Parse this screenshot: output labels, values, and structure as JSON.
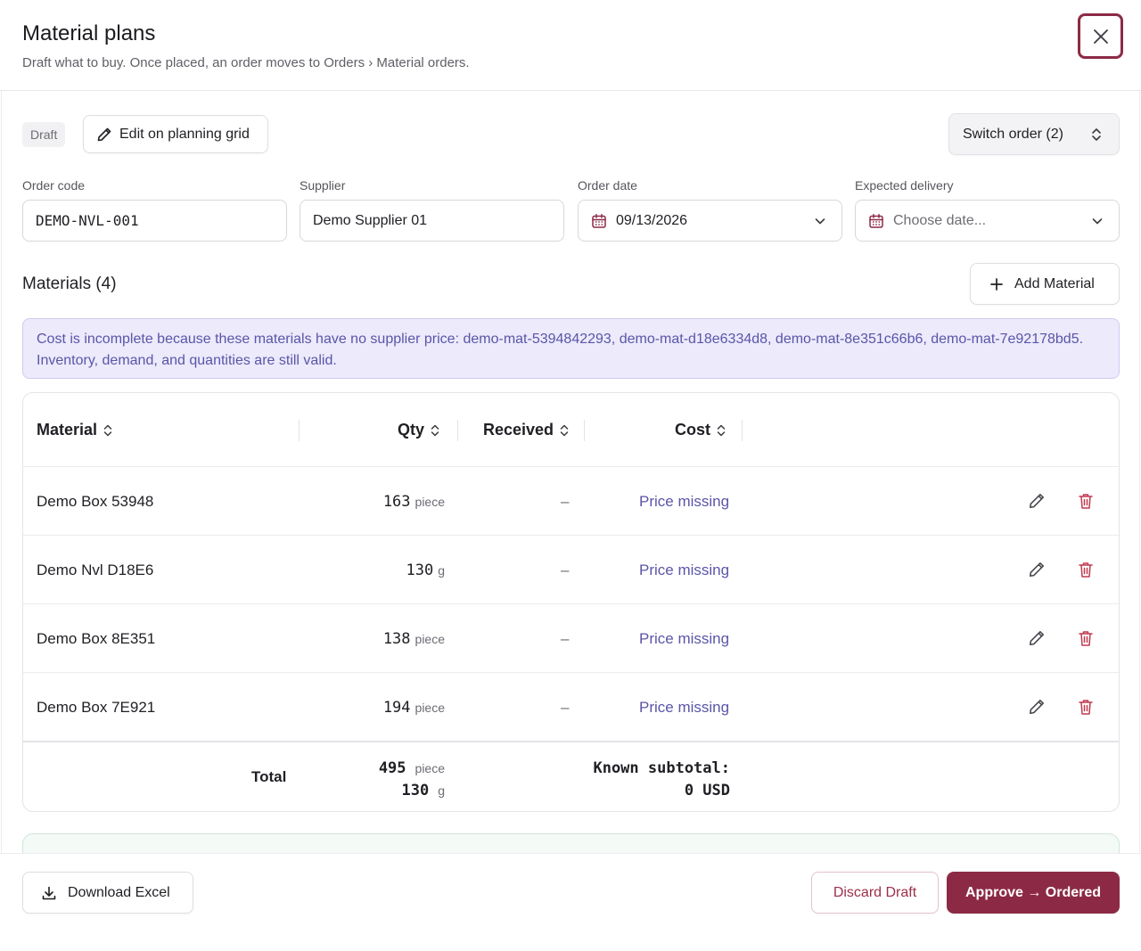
{
  "header": {
    "title": "Material plans",
    "subtitle": "Draft what to buy. Once placed, an order moves to Orders › Material orders."
  },
  "toolbar": {
    "status_badge": "Draft",
    "edit_grid_label": "Edit on planning grid",
    "switch_order_label": "Switch order (2)"
  },
  "form": {
    "order_code": {
      "label": "Order code",
      "value": "DEMO-NVL-001"
    },
    "supplier": {
      "label": "Supplier",
      "value": "Demo Supplier 01"
    },
    "order_date": {
      "label": "Order date",
      "value": "09/13/2026"
    },
    "expected_delivery": {
      "label": "Expected delivery",
      "placeholder": "Choose date..."
    }
  },
  "materials": {
    "title": "Materials (4)",
    "add_label": "Add Material",
    "alert": "Cost is incomplete because these materials have no supplier price: demo-mat-5394842293, demo-mat-d18e6334d8, demo-mat-8e351c66b6, demo-mat-7e92178bd5. Inventory, demand, and quantities are still valid.",
    "columns": {
      "material": "Material",
      "qty": "Qty",
      "received": "Received",
      "cost": "Cost"
    },
    "rows": [
      {
        "name": "Demo Box 53948",
        "qty": "163",
        "unit": "piece",
        "received": "–",
        "cost": "Price missing"
      },
      {
        "name": "Demo Nvl D18E6",
        "qty": "130",
        "unit": "g",
        "received": "–",
        "cost": "Price missing"
      },
      {
        "name": "Demo Box 8E351",
        "qty": "138",
        "unit": "piece",
        "received": "–",
        "cost": "Price missing"
      },
      {
        "name": "Demo Box 7E921",
        "qty": "194",
        "unit": "piece",
        "received": "–",
        "cost": "Price missing"
      }
    ],
    "total": {
      "label": "Total",
      "qty_lines": [
        {
          "qty": "495",
          "unit": "piece"
        },
        {
          "qty": "130",
          "unit": "g"
        }
      ],
      "subtotal_label": "Known subtotal:",
      "subtotal_value": "0 USD"
    }
  },
  "footer": {
    "download_label": "Download Excel",
    "discard_label": "Discard Draft",
    "approve_label": "Approve → Ordered"
  },
  "colors": {
    "brand": "#8c2a46",
    "alert_text": "#5b55a8",
    "alert_bg": "#eceafb",
    "danger_icon": "#c0394f"
  }
}
